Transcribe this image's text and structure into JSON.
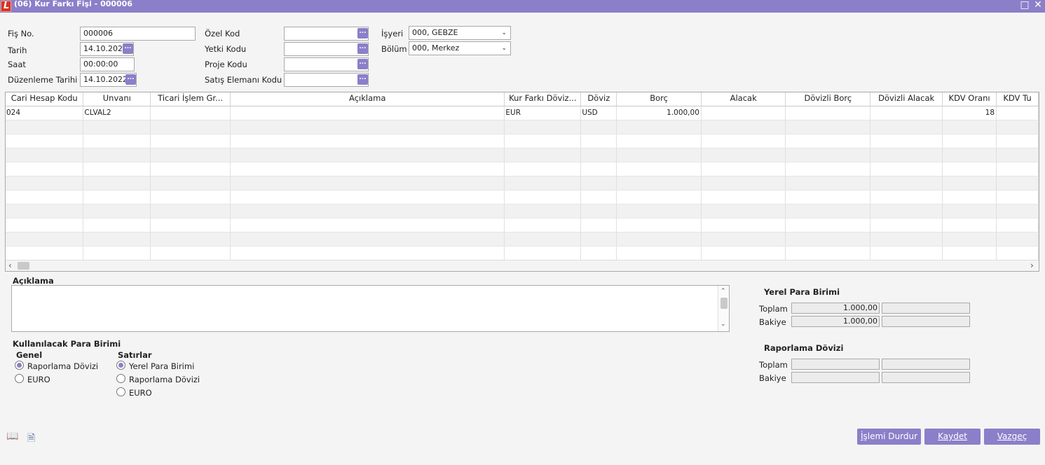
{
  "window": {
    "title": "(06) Kur Farkı Fişi - 000006",
    "maximize_icon": "□",
    "close_icon": "✕"
  },
  "header": {
    "fis_no": {
      "label": "Fiş No.",
      "value": "000006"
    },
    "tarih": {
      "label": "Tarih",
      "value": "14.10.2022"
    },
    "saat": {
      "label": "Saat",
      "value": "00:00:00"
    },
    "duzenleme_tarihi": {
      "label": "Düzenleme Tarihi",
      "value": "14.10.2022"
    },
    "ozel_kod": {
      "label": "Özel Kod",
      "value": ""
    },
    "yetki_kodu": {
      "label": "Yetki Kodu",
      "value": ""
    },
    "proje_kodu": {
      "label": "Proje Kodu",
      "value": ""
    },
    "satis_elemani_kodu": {
      "label": "Satış Elemanı Kodu",
      "value": ""
    },
    "isyeri": {
      "label": "İşyeri",
      "value": "000, GEBZE"
    },
    "bolum": {
      "label": "Bölüm",
      "value": "000, Merkez"
    },
    "lookup_button_label": "..."
  },
  "grid": {
    "columns": [
      "Cari Hesap Kodu",
      "Unvanı",
      "Ticari İşlem Gr...",
      "Açıklama",
      "Kur Farkı Döviz...",
      "Döviz",
      "Borç",
      "Alacak",
      "Dövizli Borç",
      "Dövizli Alacak",
      "KDV Oranı",
      "KDV Tu"
    ],
    "rows": [
      [
        "024",
        "CLVAL2",
        "",
        "",
        "EUR",
        "USD",
        "1.000,00",
        "",
        "",
        "",
        "18",
        ""
      ]
    ]
  },
  "aciklama": {
    "label": "Açıklama",
    "value": ""
  },
  "para_birimi": {
    "title": "Kullanılacak Para Birimi",
    "genel": {
      "title": "Genel",
      "options": [
        "Raporlama Dövizi",
        "EURO"
      ],
      "selected": 0
    },
    "satirlar": {
      "title": "Satırlar",
      "options": [
        "Yerel Para Birimi",
        "Raporlama Dövizi",
        "EURO"
      ],
      "selected": 0
    }
  },
  "totals": {
    "yerel": {
      "title": "Yerel Para Birimi",
      "toplam_label": "Toplam",
      "toplam": "1.000,00",
      "toplam2": "",
      "bakiye_label": "Bakiye",
      "bakiye": "1.000,00",
      "bakiye2": ""
    },
    "raporlama": {
      "title": "Raporlama Dövizi",
      "toplam_label": "Toplam",
      "toplam": "",
      "toplam2": "",
      "bakiye_label": "Bakiye",
      "bakiye": "",
      "bakiye2": ""
    }
  },
  "buttons": {
    "durdur": {
      "first": "İ",
      "rest": "şlemi Durdur"
    },
    "kaydet": {
      "first": "K",
      "rest": "aydet"
    },
    "vazgec": {
      "first": "V",
      "rest": "azgeç"
    }
  },
  "footer_icons": {
    "book": "📖",
    "doc": "🗎"
  }
}
